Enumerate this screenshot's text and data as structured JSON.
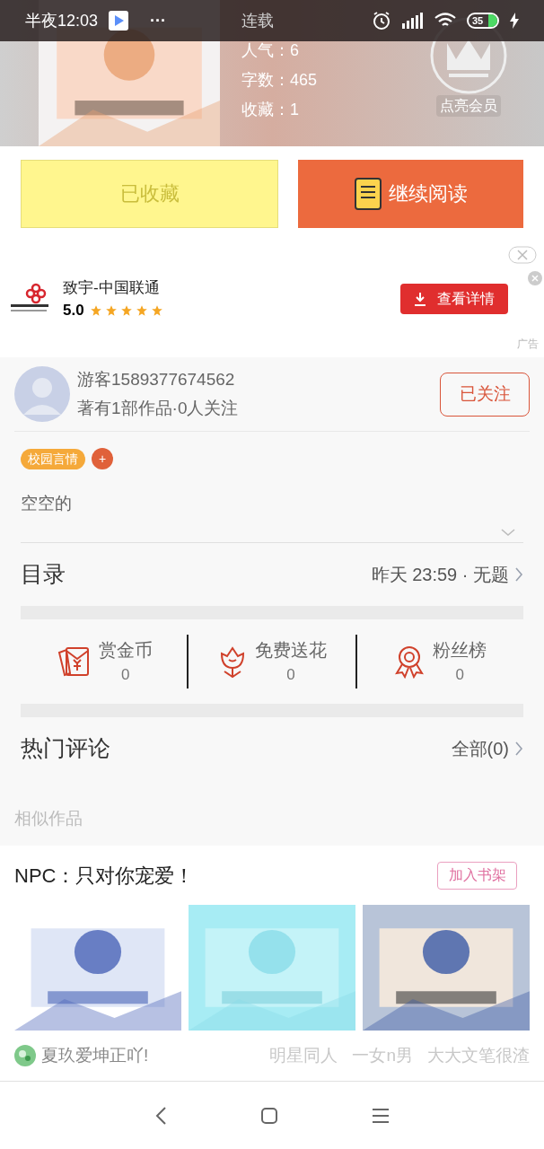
{
  "status_bar": {
    "time": "半夜12:03",
    "more": "···",
    "battery": "35"
  },
  "book": {
    "cover": {
      "kind": "picture"
    },
    "stats": [
      "连载",
      "人气：6",
      "字数：465",
      "收藏：1"
    ],
    "vip_label": "点亮会员"
  },
  "actions": {
    "collect": {
      "label": "已收藏",
      "disabled": true
    },
    "read": {
      "label": "继续阅读"
    }
  },
  "ad": {
    "name": "致宇-中国联通",
    "rating": "5.0",
    "stars": 5,
    "button": "查看详情",
    "tag": "广告"
  },
  "author": {
    "name": "游客1589377674562",
    "info": "著有1部作品·0人关注",
    "follow": {
      "label": "已关注",
      "selected": true
    }
  },
  "tags": [
    {
      "label": "校园言情",
      "color": "#f5a93a"
    }
  ],
  "tag_add": "+",
  "description": {
    "text": "空空的",
    "expanded": false
  },
  "catalog": {
    "title": "目录",
    "latest": "昨天 23:59 · 无题"
  },
  "rewards": [
    {
      "label": "赏金币",
      "count": "0",
      "kind": "envelope"
    },
    {
      "label": "免费送花",
      "count": "0",
      "kind": "flower"
    },
    {
      "label": "粉丝榜",
      "count": "0",
      "kind": "medal"
    }
  ],
  "comments": {
    "title": "热门评论",
    "all": "全部(0)"
  },
  "similar": {
    "heading": "相似作品",
    "title": "NPC：只对你宠爱！",
    "add_button": "加入书架",
    "covers": [
      {
        "kind": "picture"
      },
      {
        "kind": "picture"
      },
      {
        "kind": "picture"
      }
    ],
    "author": "夏玖爱坤正吖!",
    "tags": [
      "明星同人",
      "一女n男",
      "大大文笔很渣"
    ]
  }
}
